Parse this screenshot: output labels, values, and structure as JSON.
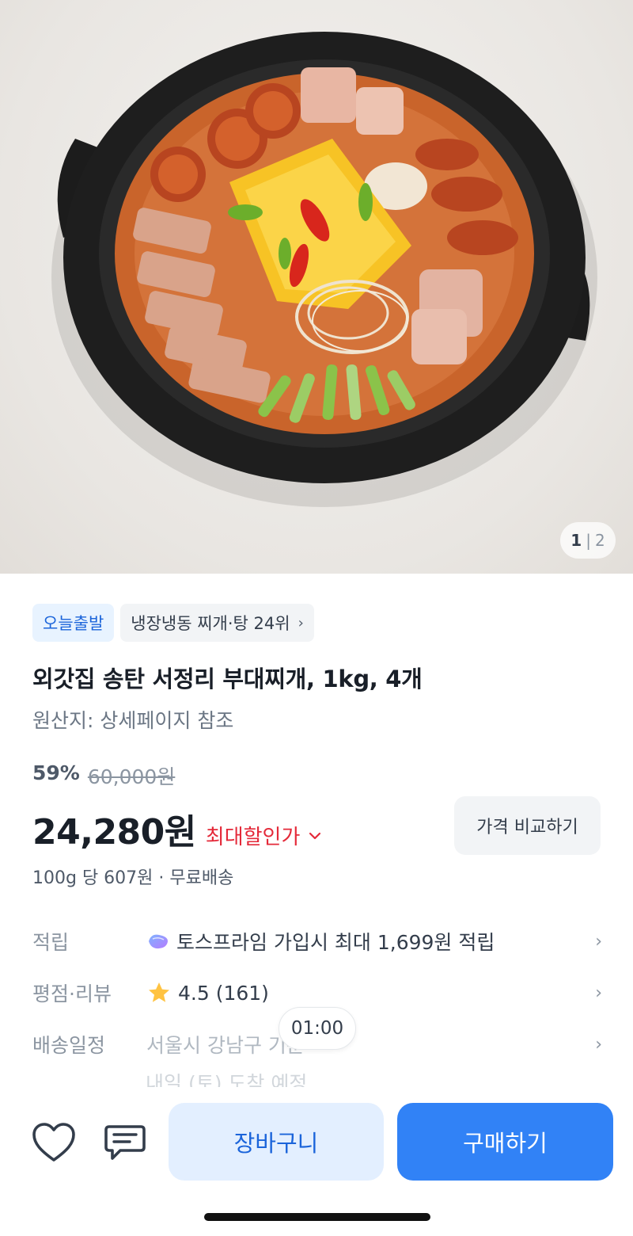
{
  "hero": {
    "image_label": "부대찌개 product photo",
    "counter_current": "1",
    "counter_separator": "|",
    "counter_total": "2"
  },
  "badges": {
    "delivery": "오늘출발",
    "ranking": "냉장냉동 찌개·탕 24위"
  },
  "product": {
    "title": "외갓집 송탄 서정리 부대찌개, 1kg, 4개",
    "origin": "원산지: 상세페이지 참조",
    "discount_percent": "59%",
    "original_price": "60,000원",
    "price": "24,280원",
    "max_discount_label": "최대할인가",
    "compare_button": "가격 비교하기",
    "unit_price": "100g 당 607원 · 무료배송"
  },
  "info": {
    "points_label": "적립",
    "points_value": "토스프라임 가입시 최대 1,699원 적립",
    "rating_label": "평점·리뷰",
    "rating_value": "4.5 (161)",
    "shipping_label": "배송일정",
    "shipping_value": "서울시 강남구 기준",
    "shipping_arrival": "내일 (토) 도착 예정"
  },
  "timer": "01:00",
  "bottom": {
    "cart_button": "장바구니",
    "buy_button": "구매하기"
  },
  "colors": {
    "primary": "#3182f6",
    "primary_light": "#e3efff",
    "discount_red": "#e42939",
    "star": "#ffc342"
  },
  "icons": [
    "heart-icon",
    "chat-icon",
    "chevron-right-icon",
    "star-icon",
    "tossprime-icon"
  ]
}
